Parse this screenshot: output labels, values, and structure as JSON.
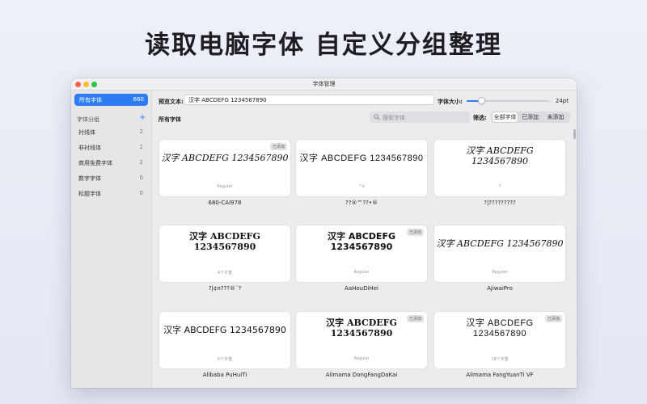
{
  "headline": "读取电脑字体 自定义分组整理",
  "window": {
    "title": "字体管理"
  },
  "sidebar": {
    "all": {
      "label": "所有字体",
      "count": "660"
    },
    "groups_header": "字体分组",
    "add_icon": "plus-icon",
    "groups": [
      {
        "label": "衬线体",
        "count": "2"
      },
      {
        "label": "非衬线体",
        "count": "1"
      },
      {
        "label": "商用免费字体",
        "count": "2"
      },
      {
        "label": "数字字体",
        "count": "0"
      },
      {
        "label": "标题字体",
        "count": "0"
      }
    ]
  },
  "toolbar": {
    "preview_label": "预览文本:",
    "preview_text": "汉字 ABCDEFG 1234567890",
    "size_label": "字体大小:",
    "size_value": "24pt",
    "size_fraction": 0.18
  },
  "section": {
    "title": "所有字体",
    "search_placeholder": "搜索字体",
    "filter_label": "筛选:",
    "filters": [
      "全部字体",
      "已添加",
      "未添加"
    ],
    "active_filter": 0
  },
  "fonts": [
    {
      "name": "680-CAI978",
      "subtitle": "Regular",
      "line1": "汉字 ABCDEFG 1234567890",
      "line2": "",
      "style": "f-script",
      "added": true
    },
    {
      "name": "??®™??•®",
      "subtitle": "™£",
      "line1": "汉字 ABCDEFG 1234567890",
      "line2": "",
      "style": "f-thin",
      "added": false
    },
    {
      "name": "?|?????????",
      "subtitle": "?",
      "line1": "汉字 ABCDEFG",
      "line2": "1234567890",
      "style": "f-hand",
      "added": false
    },
    {
      "name": "?|¢n???®¨?",
      "subtitle": "4个字重",
      "line1": "汉字 ABCDEFG",
      "line2": "1234567890",
      "style": "f-brush",
      "added": false
    },
    {
      "name": "AaHouDiHei",
      "subtitle": "Regular",
      "line1": "汉字 ABCDEFG",
      "line2": "1234567890",
      "style": "f-heavy",
      "added": true
    },
    {
      "name": "AjiwaiPro",
      "subtitle": "Regular",
      "line1": "汉字 ABCDEFG 1234567890",
      "line2": "",
      "style": "f-script",
      "added": false
    },
    {
      "name": "Alibaba PuHuiTi",
      "subtitle": "6个字重",
      "line1": "汉字 ABCDEFG 1234567890",
      "line2": "",
      "style": "f-plain",
      "added": false
    },
    {
      "name": "Alimama DongFangDaKai",
      "subtitle": "Regular",
      "line1": "汉字 ABCDEFG",
      "line2": "1234567890",
      "style": "f-brush",
      "added": true
    },
    {
      "name": "Alimama FangYuanTi VF",
      "subtitle": "18个字重",
      "line1": "汉字 ABCDEFG",
      "line2": "1234567890",
      "style": "f-thin",
      "added": true
    }
  ],
  "added_badge": "已添加",
  "colors": {
    "accent": "#2d7cf6",
    "window_bg": "#ececee",
    "card_bg": "#ffffff"
  }
}
